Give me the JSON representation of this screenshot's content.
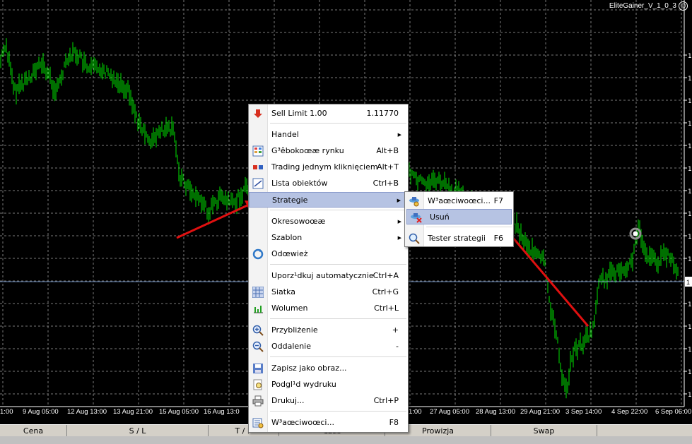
{
  "chart": {
    "ea_name": "EliteGainer_V_1_0_3",
    "x_ticks": [
      "1:00",
      "9 Aug 05:00",
      "12 Aug 13:00",
      "13 Aug 21:00",
      "15 Aug 05:00",
      "16 Aug 13:0",
      "1:00",
      "27 Aug 05:00",
      "28 Aug 13:00",
      "29 Aug 21:00",
      "3 Sep 14:00",
      "4 Sep 22:00",
      "6 Sep 06:00"
    ],
    "price_marker": "1",
    "colors": {
      "bars": "#00e000",
      "grid": "#808080",
      "bid_line": "#7090c0",
      "arrow": "#e01010"
    }
  },
  "terminal": {
    "columns": [
      "Cena",
      "S / L",
      "T / P",
      "Czas",
      "Prowizja",
      "Swap"
    ]
  },
  "context_menu": {
    "items": [
      {
        "label": "Sell Limit 1.00",
        "shortcut": "1.11770",
        "icon": "sell-arrow-icon"
      },
      {
        "label": "Handel",
        "shortcut": "",
        "submenu": true
      },
      {
        "label": "G³êbokoœæ rynku",
        "shortcut": "Alt+B",
        "icon": "market-depth-icon"
      },
      {
        "label": "Trading jednym kliknięciem",
        "shortcut": "Alt+T",
        "icon": "one-click-trading-icon"
      },
      {
        "label": "Lista obiektów",
        "shortcut": "Ctrl+B",
        "icon": "object-list-icon"
      },
      {
        "label": "Strategie",
        "shortcut": "",
        "submenu": true
      },
      {
        "label": "Okresowoœæ",
        "shortcut": "",
        "submenu": true
      },
      {
        "label": "Szablon",
        "shortcut": "",
        "submenu": true
      },
      {
        "label": "Odœwież",
        "shortcut": "",
        "icon": "refresh-icon"
      },
      {
        "label": "Uporz¹dkuj automatycznie",
        "shortcut": "Ctrl+A"
      },
      {
        "label": "Siatka",
        "shortcut": "Ctrl+G",
        "icon": "grid-icon"
      },
      {
        "label": "Wolumen",
        "shortcut": "Ctrl+L",
        "icon": "volume-icon"
      },
      {
        "label": "Przybliżenie",
        "shortcut": "+",
        "icon": "zoom-in-icon"
      },
      {
        "label": "Oddalenie",
        "shortcut": "-",
        "icon": "zoom-out-icon"
      },
      {
        "label": "Zapisz jako obraz...",
        "shortcut": "",
        "icon": "save-image-icon"
      },
      {
        "label": "Podgl¹d wydruku",
        "shortcut": "",
        "icon": "print-preview-icon"
      },
      {
        "label": "Drukuj...",
        "shortcut": "Ctrl+P",
        "icon": "print-icon"
      },
      {
        "label": "W³aœciwoœci...",
        "shortcut": "F8",
        "icon": "properties-icon"
      }
    ]
  },
  "strategy_submenu": {
    "items": [
      {
        "label": "W³aœciwoœci...",
        "shortcut": "F7",
        "icon": "expert-properties-icon"
      },
      {
        "label": "Usuń",
        "shortcut": "",
        "icon": "expert-remove-icon"
      },
      {
        "label": "Tester strategii",
        "shortcut": "F6",
        "icon": "strategy-tester-icon"
      }
    ]
  }
}
